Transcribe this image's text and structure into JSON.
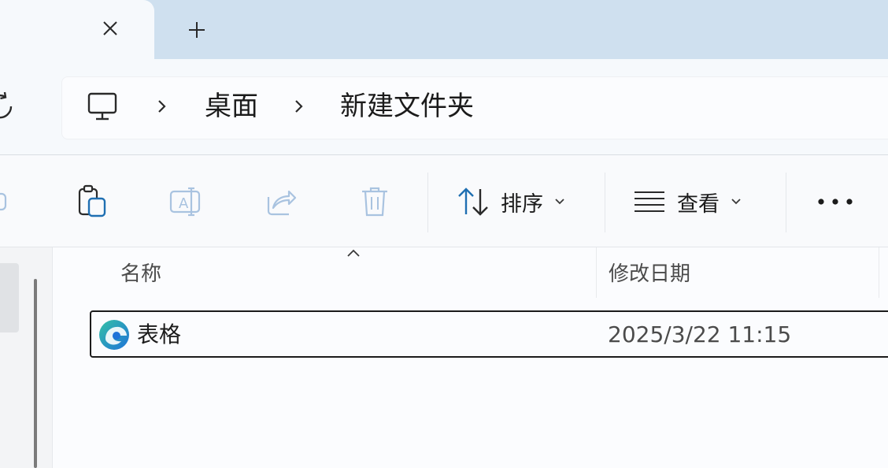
{
  "tabs": {
    "close_glyph": "✕",
    "new_glyph": "+"
  },
  "breadcrumb": {
    "items": [
      "桌面",
      "新建文件夹"
    ]
  },
  "commands": {
    "sort_label": "排序",
    "view_label": "查看",
    "more_glyph": "•••"
  },
  "columns": {
    "name": "名称",
    "modified": "修改日期"
  },
  "files": [
    {
      "name": "表格",
      "modified": "2025/3/22 11:15",
      "icon": "edge-browser-icon"
    }
  ],
  "colors": {
    "tabstrip": "#cfe0ef",
    "active_tab": "#f6f9fc",
    "icon_disabled": "#a9c3e0",
    "icon_primary": "#1f6fb2",
    "edge_teal": "#35c1a6",
    "edge_blue": "#1e73d8"
  }
}
